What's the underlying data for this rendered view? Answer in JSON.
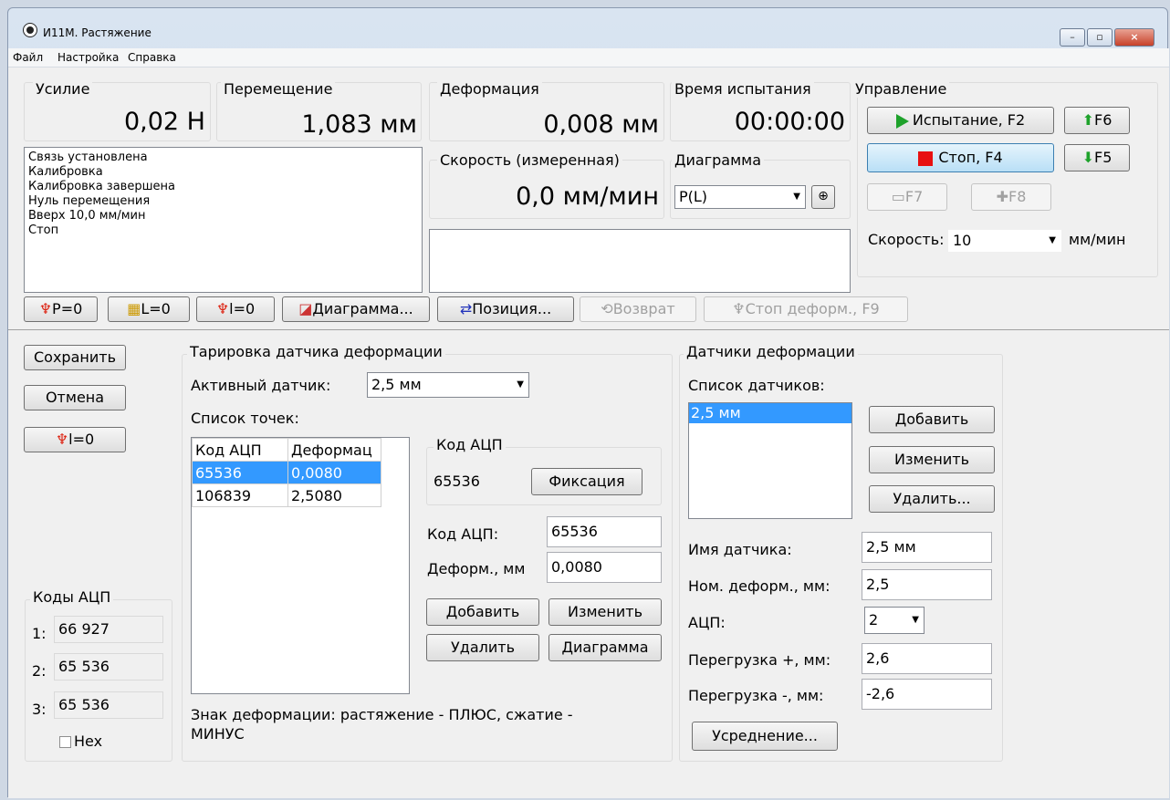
{
  "window": {
    "title": "И11М. Растяжение",
    "minimize": "–",
    "maximize": "▫",
    "close": "×"
  },
  "menu": [
    "Файл",
    "Настройка",
    "Справка"
  ],
  "force": {
    "label": "Усилие",
    "value": "0,02 Н"
  },
  "displacement": {
    "label": "Перемещение",
    "value": "1,083 мм"
  },
  "deformation": {
    "label": "Деформация",
    "value": "0,008 мм"
  },
  "test_time": {
    "label": "Время испытания",
    "value": "00:00:00"
  },
  "speed_measured": {
    "label": "Скорость (измеренная)",
    "value": "0,0 мм/мин"
  },
  "log": [
    "Связь установлена",
    "Калибровка",
    "Калибровка завершена",
    "Нуль перемещения",
    "Вверх 10,0 мм/мин",
    "Стоп"
  ],
  "diagram": {
    "label": "Диаграмма",
    "selected": "P(L)"
  },
  "control": {
    "label": "Управление",
    "test_btn": "Испытание, F2",
    "f6": "F6",
    "stop_btn": "Стоп, F4",
    "f5": "F5",
    "f7": "F7",
    "f8": "F8",
    "speed_label": "Скорость:",
    "speed_value": "10",
    "speed_unit": "мм/мин"
  },
  "toolbar": {
    "p0": "P=0",
    "l0": "L=0",
    "i0": "l=0",
    "diagram": "Диаграмма...",
    "position": "Позиция...",
    "return": "Возврат",
    "stop_def": "Стоп деформ., F9"
  },
  "left": {
    "save": "Сохранить",
    "cancel": "Отмена",
    "i0": "l=0"
  },
  "adc_codes": {
    "label": "Коды АЦП",
    "rows": [
      {
        "n": "1:",
        "v": "66 927"
      },
      {
        "n": "2:",
        "v": "65 536"
      },
      {
        "n": "3:",
        "v": "65 536"
      }
    ],
    "hex": "Hex"
  },
  "calibration": {
    "label": "Тарировка датчика деформации",
    "active_label": "Активный датчик:",
    "active_value": "2,5 мм",
    "points_label": "Список точек:",
    "columns": [
      "Код АЦП",
      "Деформац"
    ],
    "rows": [
      [
        "65536",
        "0,0080"
      ],
      [
        "106839",
        "2,5080"
      ]
    ],
    "adc_box_label": "Код АЦП",
    "adc_box_value": "65536",
    "fix_btn": "Фиксация",
    "adc_field_label": "Код АЦП:",
    "adc_field_value": "65536",
    "def_field_label": "Деформ., мм",
    "def_field_value": "0,0080",
    "add": "Добавить",
    "edit": "Изменить",
    "delete": "Удалить",
    "diagram": "Диаграмма",
    "sign_note": "Знак деформации: растяжение - ПЛЮС, сжатие - МИНУС"
  },
  "sensors": {
    "label": "Датчики деформации",
    "list_label": "Список датчиков:",
    "items": [
      "2,5 мм"
    ],
    "add": "Добавить",
    "edit": "Изменить",
    "delete": "Удалить...",
    "name_label": "Имя датчика:",
    "name_value": "2,5 мм",
    "nom_label": "Ном. деформ., мм:",
    "nom_value": "2,5",
    "adc_label": "АЦП:",
    "adc_value": "2",
    "over_plus_label": "Перегрузка +, мм:",
    "over_plus_value": "2,6",
    "over_minus_label": "Перегрузка -, мм:",
    "over_minus_value": "-2,6",
    "avg_btn": "Усреднение..."
  }
}
